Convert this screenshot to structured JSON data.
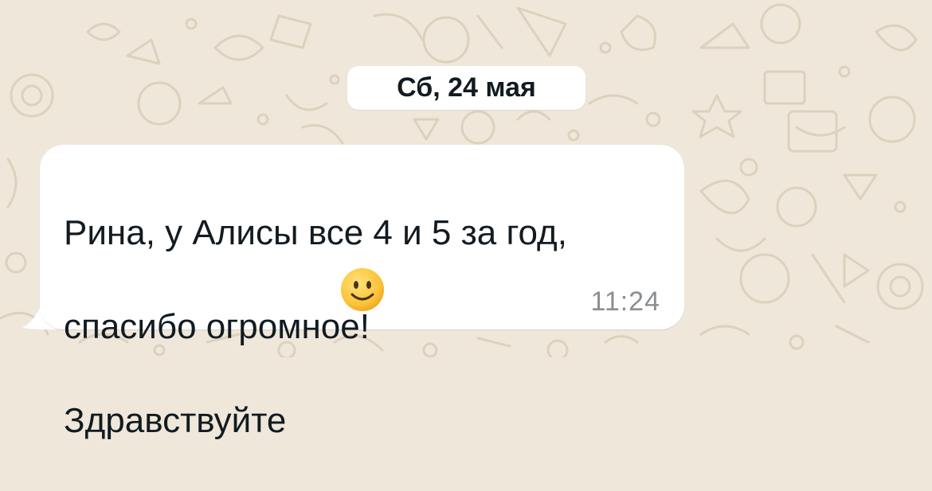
{
  "chat": {
    "background_color": "#efe7da",
    "date_separator": "Сб, 24 мая",
    "message": {
      "lines": [
        "Рина, у Алисы все 4 и 5 за год,",
        "спасибо огромное!",
        "Здравствуйте"
      ],
      "emoji": "smiling-face-icon",
      "time": "11:24",
      "bubble_color": "#ffffff",
      "direction": "incoming"
    }
  }
}
